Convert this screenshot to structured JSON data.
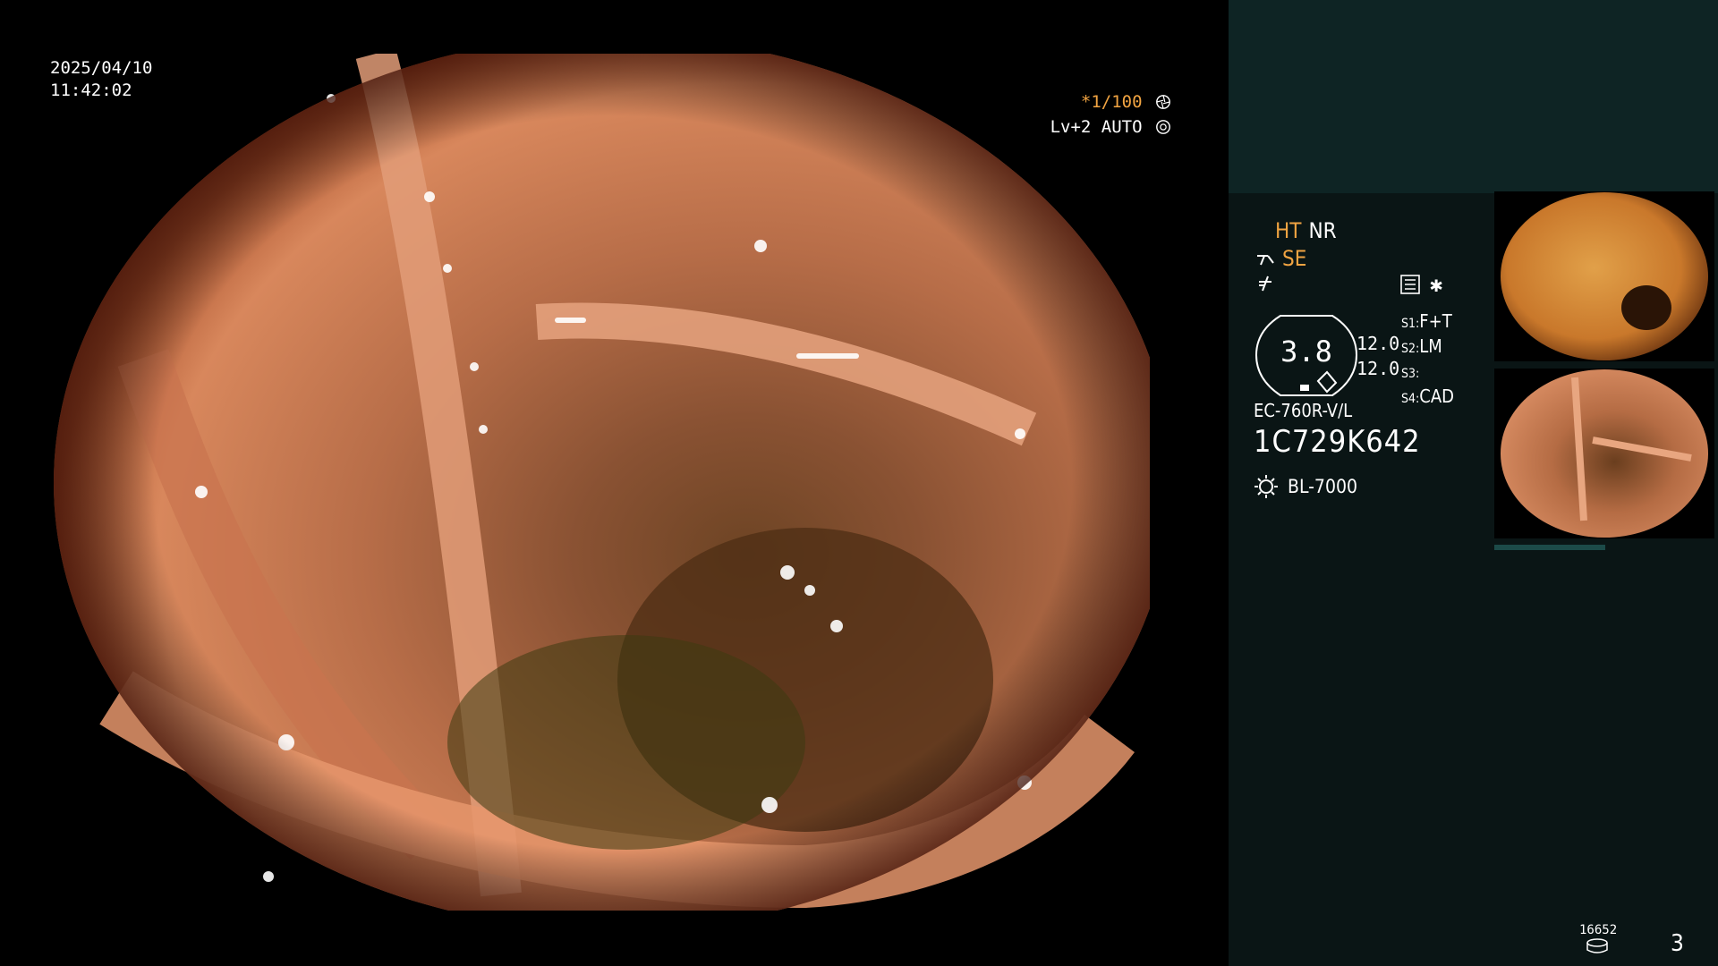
{
  "datetime": {
    "date": "2025/04/10",
    "time": "11:42:02"
  },
  "overlay": {
    "shutter": "*1/100",
    "level": "Lv+2 AUTO"
  },
  "modes": {
    "ht": "HT",
    "nr": "NR",
    "se": "SE"
  },
  "gauge": {
    "value": "3.8",
    "upper": "12.0",
    "lower": "12.0"
  },
  "settings": [
    {
      "key": "S1:",
      "value": "F+T"
    },
    {
      "key": "S2:",
      "value": "LM"
    },
    {
      "key": "S3:",
      "value": ""
    },
    {
      "key": "S4:",
      "value": "CAD"
    }
  ],
  "scope": {
    "model": "EC-760R-V/L",
    "serial": "1C729K642"
  },
  "light_source": "BL-7000",
  "footer": {
    "count": "16652",
    "page": "3"
  },
  "colors": {
    "orange": "#f1a442",
    "panel": "#0a1515",
    "panel_top": "#0e2424",
    "thumb_bar": "#1c4a48"
  },
  "icons": [
    "shutter-icon",
    "auto-icon",
    "enhancement-icon",
    "freeze-icon",
    "menu-icon",
    "light-icon",
    "disk-icon"
  ]
}
